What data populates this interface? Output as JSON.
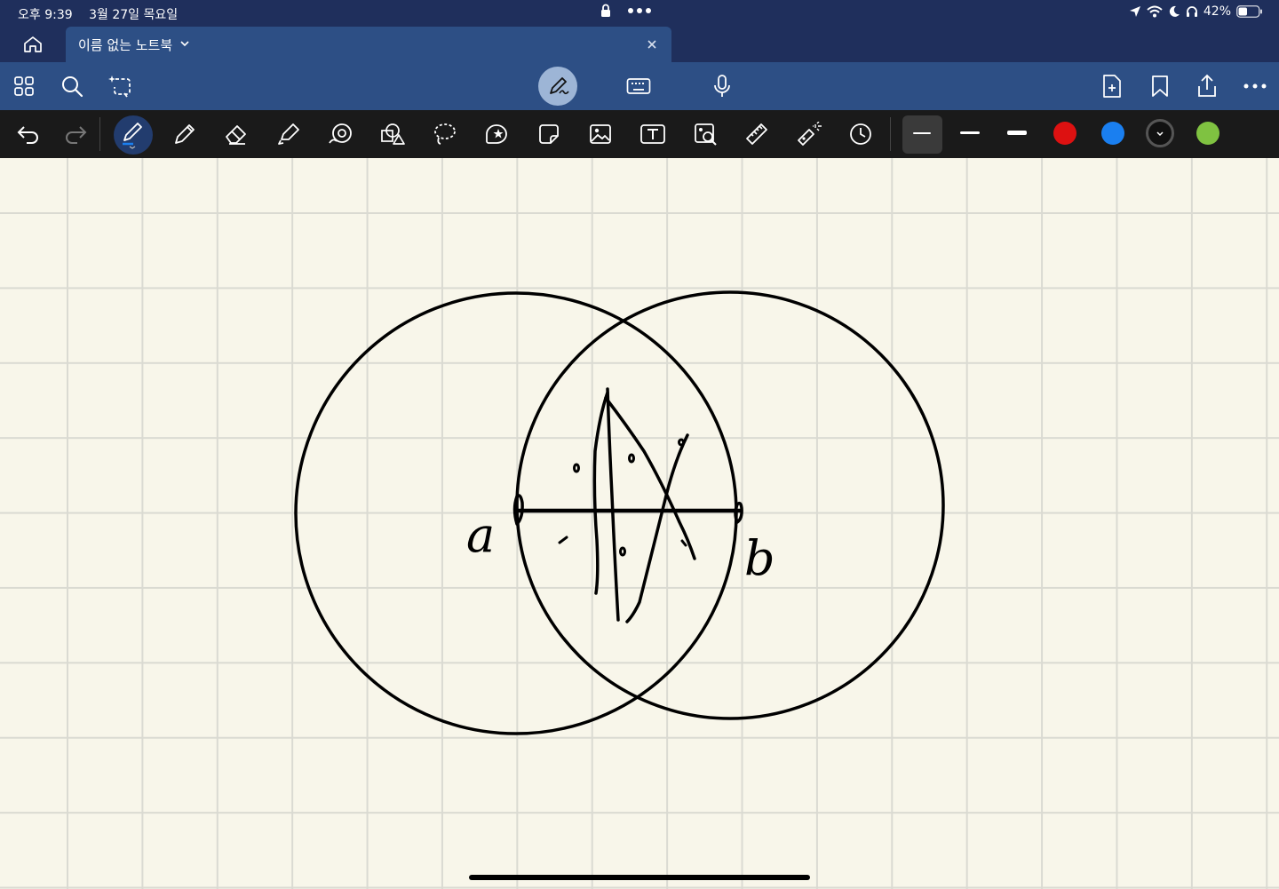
{
  "status_bar": {
    "time": "오후 9:39",
    "date": "3월 27일 목요일",
    "battery": "42%"
  },
  "tab": {
    "title": "이름 없는 노트북"
  },
  "canvas": {
    "labels": [
      "a",
      "b"
    ]
  },
  "palette": {
    "colors": [
      "#dd1111",
      "#1a7ff0",
      "#111111",
      "#7fc241"
    ],
    "accent": "#2d4f85",
    "bar": "#1f2f5c"
  },
  "icons": {
    "toolbar_left": [
      "grid-icon",
      "search-icon",
      "lasso-sparkle-icon"
    ],
    "toolbar_right": [
      "add-page-icon",
      "bookmark-icon",
      "share-icon",
      "more-icon"
    ],
    "pen_tools": [
      "undo-icon",
      "redo-icon",
      "fountain-pen-icon",
      "pencil-icon",
      "eraser-icon",
      "highlighter-icon",
      "shape-icon",
      "shapes-icon",
      "lasso-icon",
      "sticker-icon",
      "sticky-note-icon",
      "image-icon",
      "text-box-icon",
      "scan-icon",
      "ruler-icon",
      "laser-pointer-icon",
      "history-icon"
    ]
  }
}
